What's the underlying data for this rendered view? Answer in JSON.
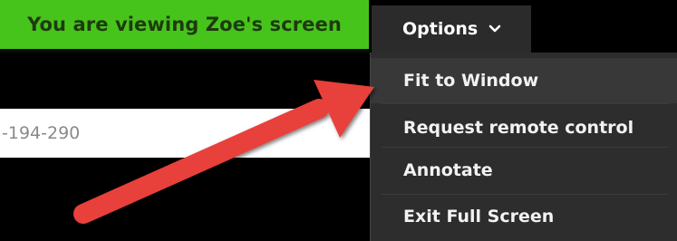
{
  "banner": {
    "text": "You are viewing Zoe's screen",
    "color": "#47c41b"
  },
  "options": {
    "label": "Options",
    "icon": "chevron-down-icon"
  },
  "url_field": {
    "value": "-194-290"
  },
  "menu": {
    "items": [
      {
        "label": "Fit to Window"
      },
      {
        "label": "Request remote control"
      },
      {
        "label": "Annotate"
      },
      {
        "label": "Exit Full Screen"
      }
    ]
  },
  "annotation": {
    "type": "arrow",
    "color": "#e8403b"
  }
}
